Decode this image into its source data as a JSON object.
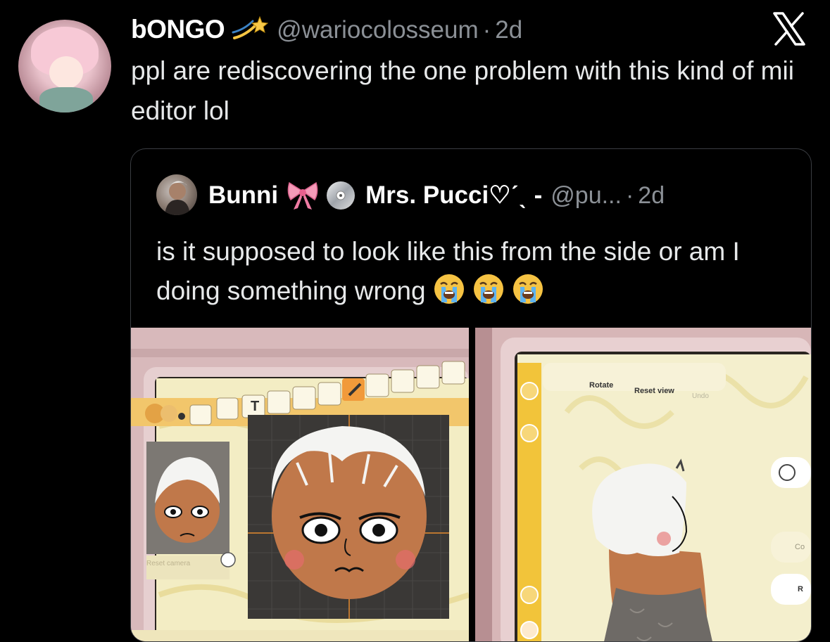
{
  "tweet": {
    "author_name": "bONGO",
    "author_handle": "@wariocolosseum",
    "separator": "·",
    "time": "2d",
    "text": "ppl are rediscovering the one problem with this kind of mii editor lol"
  },
  "quoted": {
    "author_name": "Bunni",
    "author_name_2": "Mrs. Pucci♡ˊˎ -",
    "author_handle": "@pu...",
    "separator": "·",
    "time": "2d",
    "text": "is it supposed to look like this from the side or am I doing something wrong"
  },
  "media": {
    "left": {
      "reset_camera_label": "Reset camera"
    },
    "right": {
      "rotate_label": "Rotate",
      "reset_view_label": "Reset view",
      "undo_label": "Undo",
      "co_label": "Co",
      "r_label": "R"
    }
  },
  "icons": {
    "platform": "x-logo",
    "shooting_star": "shooting-star-icon",
    "bow": "bow-icon",
    "cd": "cd-icon",
    "sob": "loudly-crying-face-icon"
  },
  "colors": {
    "background": "#000000",
    "name": "#ffffff",
    "secondary": "#8b9096",
    "editor_yellow": "#f1e7a6",
    "editor_orange": "#f2b534",
    "skin": "#c0784a"
  }
}
